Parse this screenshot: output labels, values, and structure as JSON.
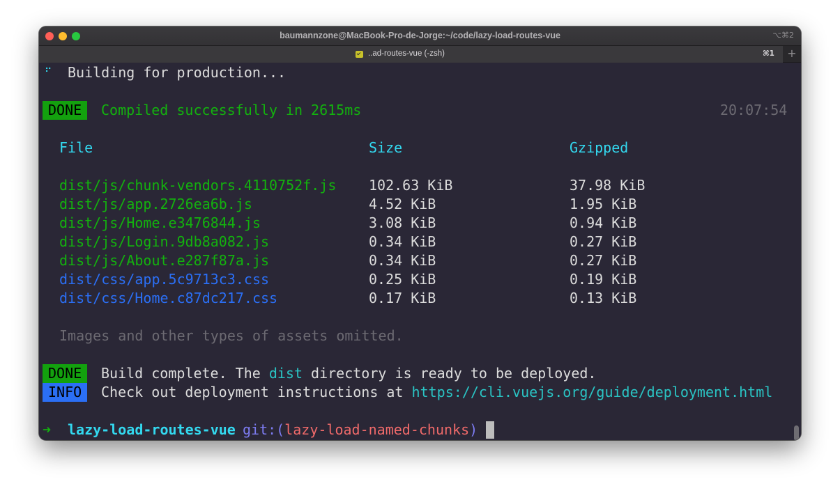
{
  "window": {
    "title": "baumannzone@MacBook-Pro-de-Jorge:~/code/lazy-load-routes-vue",
    "title_shortcut": "⌥⌘2",
    "tab_label": "..ad-routes-vue (-zsh)",
    "tab_shortcut": "⌘1",
    "new_tab": "+"
  },
  "terminal": {
    "building": {
      "spinner": "⠋",
      "text": "Building for production..."
    },
    "compiled": {
      "badge": "DONE",
      "text": "Compiled successfully in 2615ms",
      "time": "20:07:54"
    },
    "headers": {
      "file": "File",
      "size": "Size",
      "gzipped": "Gzipped"
    },
    "files": [
      {
        "file": "dist/js/chunk-vendors.4110752f.js",
        "size": "102.63 KiB",
        "gzipped": "37.98 KiB",
        "kind": "js"
      },
      {
        "file": "dist/js/app.2726ea6b.js",
        "size": "4.52 KiB",
        "gzipped": "1.95 KiB",
        "kind": "js"
      },
      {
        "file": "dist/js/Home.e3476844.js",
        "size": "3.08 KiB",
        "gzipped": "0.94 KiB",
        "kind": "js"
      },
      {
        "file": "dist/js/Login.9db8a082.js",
        "size": "0.34 KiB",
        "gzipped": "0.27 KiB",
        "kind": "js"
      },
      {
        "file": "dist/js/About.e287f87a.js",
        "size": "0.34 KiB",
        "gzipped": "0.27 KiB",
        "kind": "js"
      },
      {
        "file": "dist/css/app.5c9713c3.css",
        "size": "0.25 KiB",
        "gzipped": "0.19 KiB",
        "kind": "css"
      },
      {
        "file": "dist/css/Home.c87dc217.css",
        "size": "0.17 KiB",
        "gzipped": "0.13 KiB",
        "kind": "css"
      }
    ],
    "omitted": "Images and other types of assets omitted.",
    "build_complete": {
      "badge": "DONE",
      "before": "Build complete. The ",
      "dist": "dist",
      "after": " directory is ready to be deployed."
    },
    "info": {
      "badge": "INFO",
      "text": "Check out deployment instructions at ",
      "url": "https://cli.vuejs.org/guide/deployment.html"
    },
    "prompt": {
      "arrow": "➜",
      "dir": "lazy-load-routes-vue",
      "git": "git:",
      "paren_open": "(",
      "branch": "lazy-load-named-chunks",
      "paren_close": ")"
    }
  },
  "colors": {
    "background": "#2a2736",
    "done_badge": "#13a10e",
    "info_badge": "#2b6ff5",
    "js_file": "#13b20e",
    "css_file": "#2b6ff5",
    "header": "#33d9f0"
  }
}
